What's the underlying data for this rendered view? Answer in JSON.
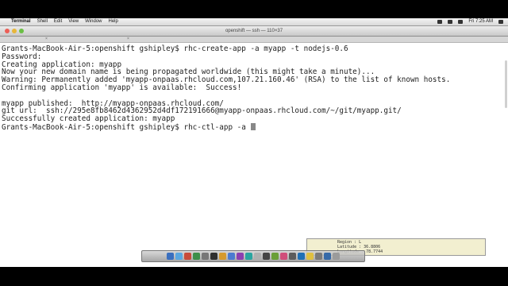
{
  "menubar": {
    "apple_glyph": "",
    "items": [
      "Terminal",
      "Shell",
      "Edit",
      "View",
      "Window",
      "Help"
    ],
    "clock": "Fri 7:25 AM"
  },
  "window": {
    "title": "openshift — ssh — 110×37"
  },
  "terminal": {
    "lines": [
      "Grants-MacBook-Air-5:openshift gshipley$ rhc-create-app -a myapp -t nodejs-0.6",
      "Password:",
      "Creating application: myapp",
      "Now your new domain name is being propagated worldwide (this might take a minute)...",
      "Warning: Permanently added 'myapp-onpaas.rhcloud.com,107.21.160.46' (RSA) to the list of known hosts.",
      "Confirming application 'myapp' is available:  Success!",
      "",
      "myapp published:  http://myapp-onpaas.rhcloud.com/",
      "git url:  ssh://295e8fb8462d4362952d4df172191666@myapp-onpaas.rhcloud.com/~/git/myapp.git/",
      "Successfully created application: myapp"
    ],
    "prompt_line": "Grants-MacBook-Air-5:openshift gshipley$ rhc-ctl-app -a "
  },
  "info_panel": {
    "rows": [
      "Region : L",
      "Latitude : 36.8806",
      "Longitude : 78.7744"
    ]
  },
  "dock": {
    "icon_colors": [
      "#3a6fbf",
      "#5aa7e0",
      "#c84b3a",
      "#3d8f4a",
      "#777777",
      "#2f2f2f",
      "#d69a2d",
      "#4b7bd0",
      "#8c3fb0",
      "#2aa5a0",
      "#b0b0b0",
      "#444444",
      "#6a9f38",
      "#d04e7a",
      "#5c5c5c",
      "#1f6fb5",
      "#e0c040",
      "#7a7a7a",
      "#3569a8",
      "#9b9b9b"
    ]
  }
}
